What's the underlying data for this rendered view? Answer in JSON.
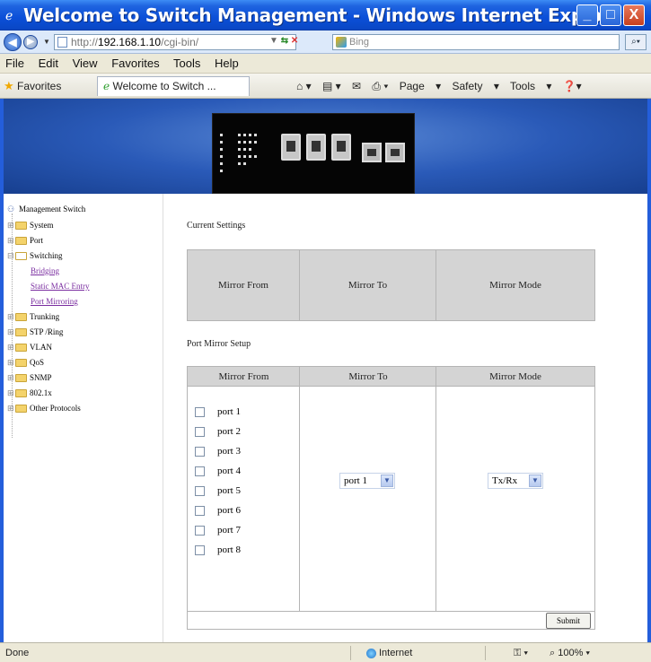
{
  "window": {
    "title": "Welcome to Switch Management - Windows Internet Explorer",
    "min_label": "_",
    "max_label": "□",
    "close_label": "X"
  },
  "address": {
    "url_prefix": "http://",
    "url_host": "192.168.1.10",
    "url_suffix": "/cgi-bin/",
    "search_placeholder": "Bing"
  },
  "menu": {
    "items": [
      "File",
      "Edit",
      "View",
      "Favorites",
      "Tools",
      "Help"
    ]
  },
  "favorites": {
    "label": "Favorites",
    "tab_title": "Welcome to Switch ...",
    "page_label": "Page",
    "safety_label": "Safety",
    "tools_label": "Tools"
  },
  "sidebar": {
    "root": "Management Switch",
    "items": [
      {
        "label": "System"
      },
      {
        "label": "Port"
      },
      {
        "label": "Switching"
      },
      {
        "label": "Bridging"
      },
      {
        "label": "Static MAC Entry"
      },
      {
        "label": "Port Mirroring"
      },
      {
        "label": "Trunking"
      },
      {
        "label": "STP /Ring"
      },
      {
        "label": "VLAN"
      },
      {
        "label": "QoS"
      },
      {
        "label": "SNMP"
      },
      {
        "label": "802.1x"
      },
      {
        "label": "Other Protocols"
      }
    ]
  },
  "current": {
    "title": "Current Settings",
    "columns": [
      "Mirror From",
      "Mirror To",
      "Mirror Mode"
    ]
  },
  "setup": {
    "title": "Port Mirror Setup",
    "columns": [
      "Mirror From",
      "Mirror To",
      "Mirror Mode"
    ],
    "ports": [
      "port 1",
      "port 2",
      "port 3",
      "port 4",
      "port 5",
      "port 6",
      "port 7",
      "port 8"
    ],
    "mirror_to_value": "port 1",
    "mirror_mode_value": "Tx/Rx",
    "submit_label": "Submit"
  },
  "status": {
    "left": "Done",
    "zone": "Internet",
    "zoom": "100%"
  }
}
